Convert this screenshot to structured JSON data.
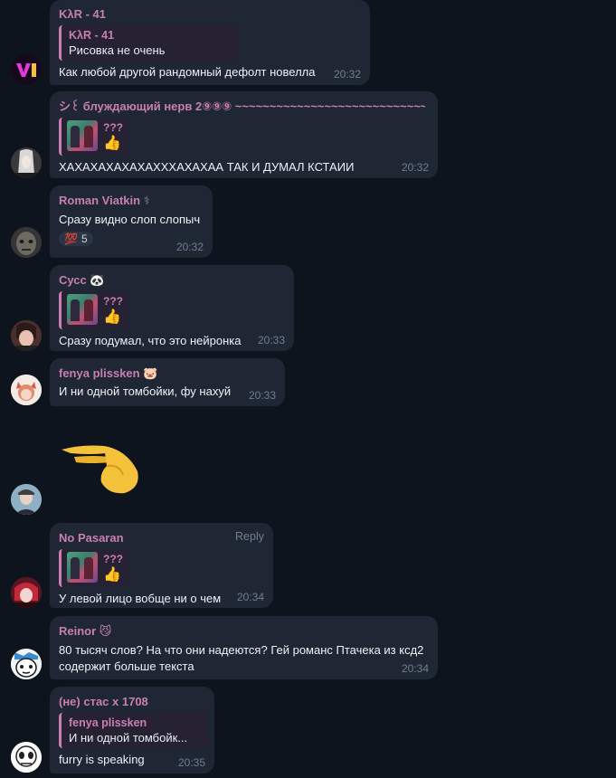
{
  "messages": [
    {
      "author": "KλR - 41",
      "quote_name": "KλR - 41",
      "quote_text": "Рисовка не очень",
      "text": "Как любой другой рандомный дефолт новелла",
      "time": "20:32"
    },
    {
      "author": "シ꒰ блуждающий нерв 2⑨⑨⑨ ~~~~~~~~~~~~~~~~~~~~~~~~~~~~~~",
      "quote_name": "???",
      "quote_emoji": "👍",
      "text": "ХАХАХАХАХАХАХХХАХАХАА ТАК И ДУМАЛ КСТАИИ",
      "time": "20:32"
    },
    {
      "author": "Roman Viatkin",
      "badge": "⚕",
      "text": "Сразу видно слоп слопыч",
      "reaction_emoji": "💯",
      "reaction_count": "5",
      "time": "20:32"
    },
    {
      "author": "Сусс",
      "badge": "🐼",
      "quote_name": "???",
      "quote_emoji": "👍",
      "text": "Сразу подумал, что это нейронка",
      "time": "20:33"
    },
    {
      "author": "fenya plissken",
      "badge": "🐷",
      "text": "И ни одной томбойки, фу нахуй",
      "time": "20:33"
    },
    {
      "sticker": "🤏"
    },
    {
      "author": "No Pasaran",
      "reply": "Reply",
      "quote_name": "???",
      "quote_emoji": "👍",
      "text": "У левой лицо вобще ни о чем",
      "time": "20:34"
    },
    {
      "author": "Reinor",
      "badge": "😼",
      "text_lines": [
        "80 тысяч слов? На что они надеются? Гей романс Птачека из ксд2",
        "содержит больше текста"
      ],
      "time": "20:34"
    },
    {
      "author": "(не) стас х 1708",
      "quote_name": "fenya plissken",
      "quote_text": "И ни одной томбойк...",
      "text": "furry is speaking",
      "time": "20:35"
    }
  ],
  "avatars": {
    "a1": "VI"
  },
  "colors": {
    "bubble": "#1e2733",
    "author": "#c97fb0",
    "time": "#6f7f90",
    "background": "#0e141d"
  }
}
